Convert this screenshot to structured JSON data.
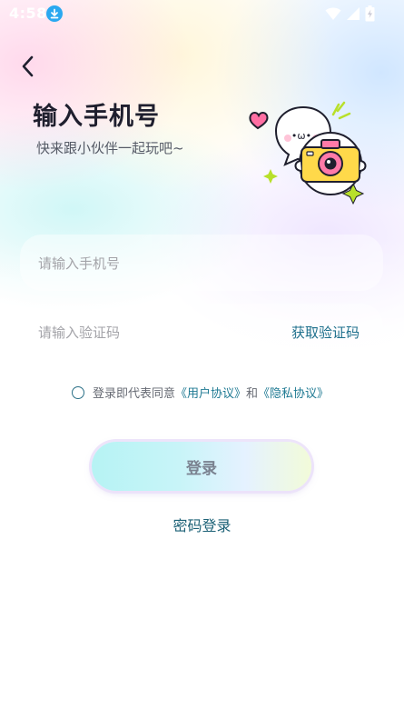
{
  "status_bar": {
    "time": "4:58",
    "icons": [
      "download-icon",
      "wifi-icon",
      "cellular-signal-icon",
      "battery-charging-icon"
    ]
  },
  "header": {
    "title": "输入手机号",
    "subtitle": "快来跟小伙伴一起玩吧~"
  },
  "mascot": {
    "face_text": "•ω•"
  },
  "form": {
    "phone_placeholder": "请输入手机号",
    "code_placeholder": "请输入验证码",
    "get_code_label": "获取验证码"
  },
  "agreement": {
    "prefix": "登录即代表同意",
    "user_agreement": "《用户协议》",
    "conjunction": "和",
    "privacy_agreement": "《隐私协议》"
  },
  "actions": {
    "login_label": "登录",
    "password_login_label": "密码登录"
  },
  "colors": {
    "accent": "#1d6f8c",
    "title": "#1f1f2e",
    "status_text": "#ffffff",
    "download_badge": "#2aa8f0"
  }
}
